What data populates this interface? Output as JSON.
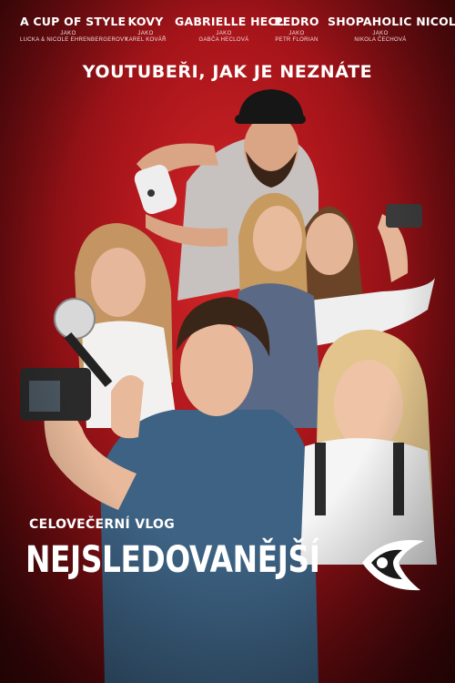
{
  "cast": [
    {
      "name": "A CUP OF STYLE",
      "as": "JAKO",
      "actor": "LUCKA & NICOLE EHRENBERGEROVY"
    },
    {
      "name": "KOVY",
      "as": "JAKO",
      "actor": "KAREL KOVÁŘ"
    },
    {
      "name": "GABRIELLE HECL",
      "as": "JAKO",
      "actor": "GABČA HECLOVÁ"
    },
    {
      "name": "PEDRO",
      "as": "JAKO",
      "actor": "PETR FLORIAN"
    },
    {
      "name": "SHOPAHOLIC NICOL",
      "as": "JAKO",
      "actor": "NIKOLA ČECHOVÁ"
    }
  ],
  "tagline": "YOUTUBEŘI, JAK JE NEZNÁTE",
  "subtitle": "CELOVEČERNÍ VLOG",
  "title": "NEJSLEDOVANĚJŠÍ",
  "colors": {
    "background": "#b5171b",
    "text": "#ffffff"
  },
  "icons": {
    "logo": "eye-logo"
  }
}
